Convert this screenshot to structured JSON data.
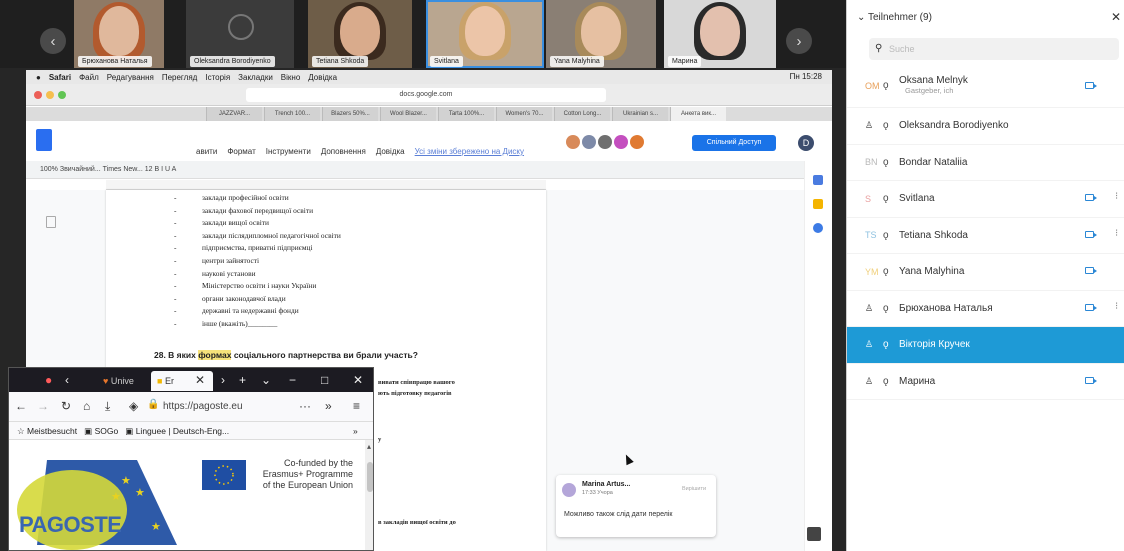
{
  "participants_strip": {
    "tiles": [
      {
        "label": "Брюханова Наталья"
      },
      {
        "label": "Oleksandra Borodiyenko"
      },
      {
        "label": "Tetiana Shkoda"
      },
      {
        "label": "Svitlana"
      },
      {
        "label": "Yana Malyhina"
      },
      {
        "label": "Марина"
      }
    ]
  },
  "mac_menubar": {
    "app": "Safari",
    "menu": [
      "Файл",
      "Редагування",
      "Перегляд",
      "Історія",
      "Закладки",
      "Вікно",
      "Довідка"
    ],
    "clock": "Пн 15:28"
  },
  "safari": {
    "url": "docs.google.com",
    "tabs": [
      "JAZZVAR...",
      "Trench 100...",
      "Blazers 50%...",
      "Wool Blazer...",
      "Tarta 100%...",
      "Women's 70...",
      "Cotton Long...",
      "Ukrainian s...",
      "Анкета вик..."
    ]
  },
  "docs": {
    "menu": [
      "авити",
      "Формат",
      "Інструменти",
      "Доповнення",
      "Довідка"
    ],
    "saved_link": "Усі зміни збережено на Диску",
    "share_button": "Спільний Доступ",
    "user_initial": "D",
    "toolbar_text": "100%   Звичайний...   Times New...   12   B  I  U  A",
    "bullets": [
      "заклади професійної освіти",
      "заклади фахової передвищої освіти",
      "заклади вищої освіти",
      "заклади післядипломної педагогічної освіти",
      "підприємства, приватні підприємці",
      "центри зайнятості",
      "наукові установи",
      "Міністерство освіти і науки України",
      "органи законодавчої влади",
      "державні та недержавні фонди",
      "інше (вкажіть)________"
    ],
    "question_prefix": "28. В яких ",
    "question_highlight": "формах",
    "question_suffix": " соціального партнерства ви брали участь?",
    "partial_line_1": "вивати співпрацю вашого",
    "partial_line_2": "ють підготовку педагогів",
    "partial_line_3": "у",
    "partial_line_4": "в закладів вищої освіти до",
    "comment": {
      "author": "Marina Artus...",
      "time": "17:33 Учора",
      "resolve": "Вирішити",
      "text": "Можливо також слід дати перелік"
    }
  },
  "firefox": {
    "tab1": "Unive",
    "tab2": "Er",
    "url": "https://pagoste.eu",
    "bookmarks": [
      "Meistbesucht",
      "SOGo",
      "Linguee | Deutsch-Eng..."
    ],
    "logo_text": "PAGOSTE",
    "eu_text": "Co-funded by the Erasmus+ Programme of the European Union"
  },
  "panel": {
    "title": "Teilnehmer (9)",
    "search_placeholder": "Suche",
    "participants": [
      {
        "initials": "OM",
        "name": "Oksana Melnyk",
        "sub": "Gastgeber, ich",
        "cam": true
      },
      {
        "initials": "",
        "name": "Oleksandra Borodiyenko",
        "sub": "",
        "cam": false
      },
      {
        "initials": "BN",
        "name": "Bondar Nataliia",
        "sub": "",
        "cam": false
      },
      {
        "initials": "S",
        "name": "Svitlana",
        "sub": "",
        "cam": true
      },
      {
        "initials": "TS",
        "name": "Tetiana Shkoda",
        "sub": "",
        "cam": true
      },
      {
        "initials": "YM",
        "name": "Yana Malyhina",
        "sub": "",
        "cam": true
      },
      {
        "initials": "",
        "name": "Брюханова Наталья",
        "sub": "",
        "cam": true
      },
      {
        "initials": "",
        "name": "Вікторія Кручек",
        "sub": "",
        "cam": false
      },
      {
        "initials": "",
        "name": "Марина",
        "sub": "",
        "cam": true
      }
    ]
  }
}
